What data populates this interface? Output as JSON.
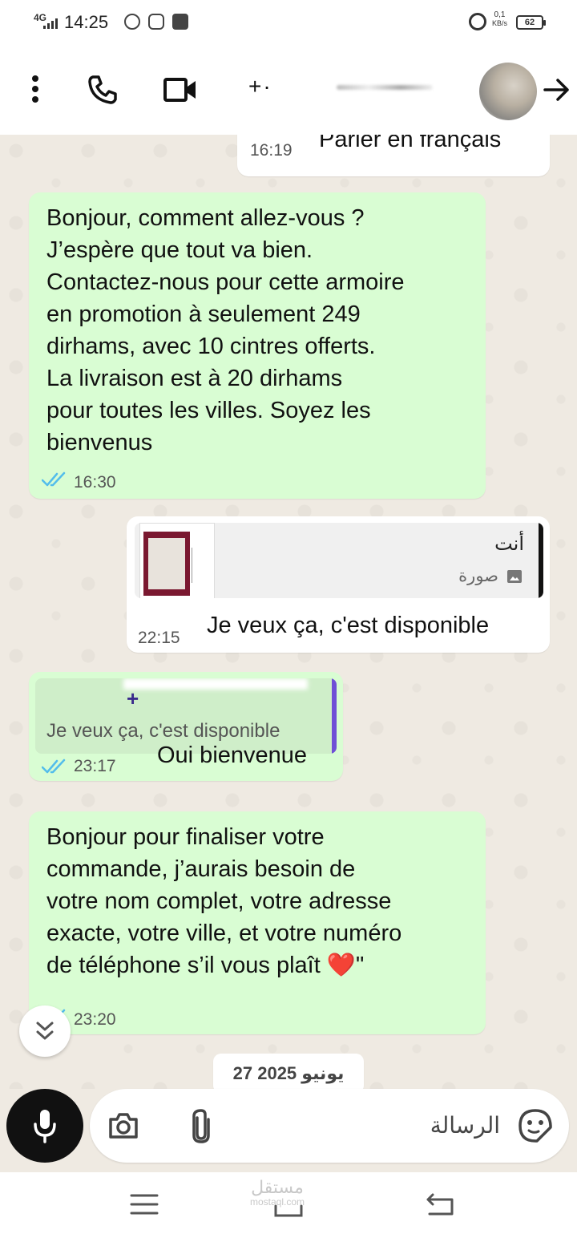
{
  "status_bar": {
    "network": "4G",
    "time": "14:25",
    "speed_value": "0,1",
    "speed_unit": "KB/s",
    "battery": "62"
  },
  "header": {
    "contact_name": "+·"
  },
  "messages": [
    {
      "direction": "incoming",
      "text": "Parler en français",
      "time": "16:19"
    },
    {
      "direction": "outgoing",
      "text": "Bonjour, comment allez-vous ?\nJ’espère que tout va bien.\nContactez-nous pour cette armoire\nen promotion à seulement 249\ndirhams, avec 10 cintres offerts.\nLa livraison est à 20 dirhams\npour toutes les villes. Soyez les\nbienvenus",
      "time": "16:30"
    },
    {
      "direction": "incoming",
      "reply_to_author": "أنت",
      "reply_to_text": "صورة",
      "text": "Je veux ça, c'est disponible",
      "time": "22:15"
    },
    {
      "direction": "outgoing",
      "reply_to_author": "+",
      "reply_to_text": "Je veux ça, c'est disponible",
      "text": "Oui bienvenue",
      "time": "23:17"
    },
    {
      "direction": "outgoing",
      "text": "Bonjour pour finaliser votre\ncommande, j’aurais besoin de\nvotre nom complet, votre adresse\nexacte, votre ville, et votre numéro\nde téléphone s’il vous plaît ❤️\"",
      "time": "23:20"
    }
  ],
  "date_separator": "27 يونيو 2025",
  "input": {
    "placeholder": "الرسالة"
  },
  "watermark": {
    "text": "مستقل",
    "domain": "mostaql.com"
  },
  "colors": {
    "outgoing_bubble": "#d9fdd3",
    "incoming_bubble": "#ffffff",
    "read_ticks": "#53bdeb",
    "chat_background": "#efeae2",
    "reply_bar_in": "#111111",
    "reply_bar_out": "#6f4fd6"
  },
  "icons": [
    "kebab-menu-icon",
    "phone-icon",
    "video-call-icon",
    "back-arrow-icon",
    "image-icon",
    "double-check-icon",
    "chevron-double-down-icon",
    "mic-icon",
    "camera-icon",
    "paperclip-icon",
    "sticker-icon",
    "menu-icon",
    "home-icon",
    "back-icon"
  ]
}
